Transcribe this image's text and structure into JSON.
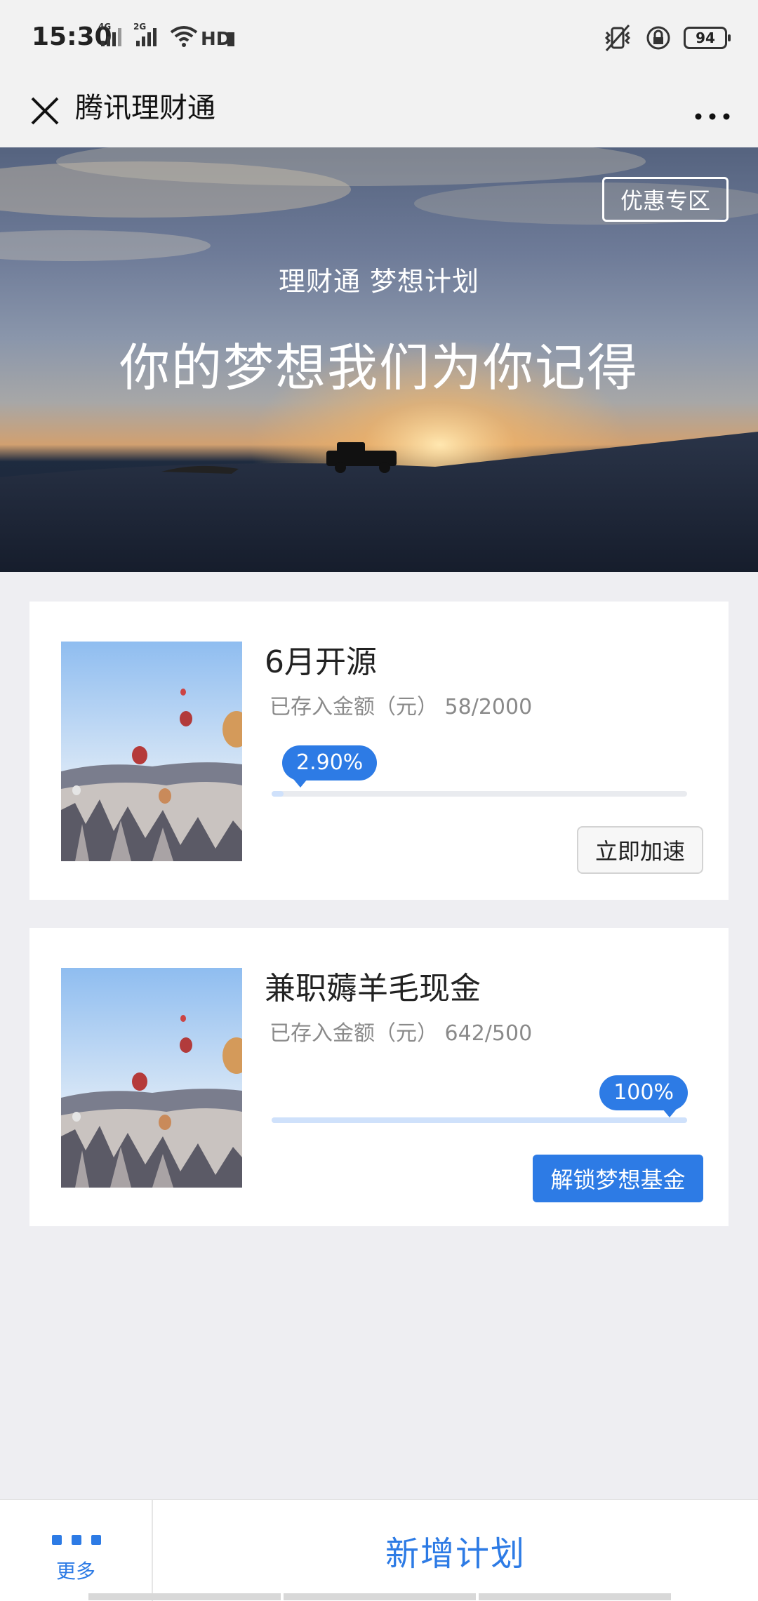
{
  "status_bar": {
    "time": "15:30",
    "net1": "4G",
    "net2": "2G",
    "hd": "HD",
    "battery": "94"
  },
  "nav": {
    "title": "腾讯理财通"
  },
  "banner": {
    "promo_label": "优惠专区",
    "subtitle": "理财通 梦想计划",
    "title": "你的梦想我们为你记得"
  },
  "plans": [
    {
      "title": "6月开源",
      "saved_label": "已存入金额（元）",
      "saved_value": "58/2000",
      "progress_label": "2.90%",
      "progress": 0.029,
      "action": "立即加速"
    },
    {
      "title": "兼职薅羊毛现金",
      "saved_label": "已存入金额（元）",
      "saved_value": "642/500",
      "progress_label": "100%",
      "progress": 1.0,
      "action": "解锁梦想基金"
    }
  ],
  "bottom": {
    "more_label": "更多",
    "new_plan": "新增计划"
  },
  "colors": {
    "accent": "#2d7be5",
    "progress_fill": "#cfe1fb"
  }
}
